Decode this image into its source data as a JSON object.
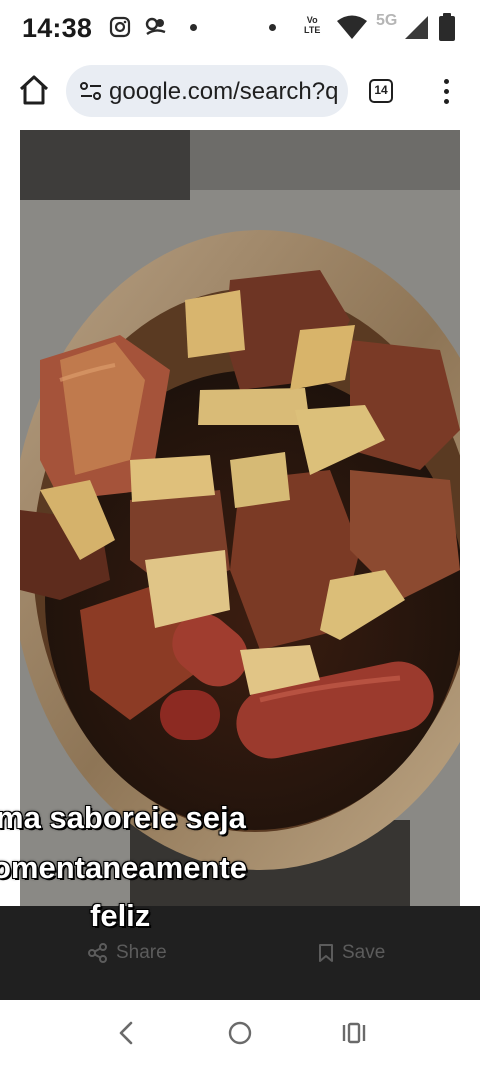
{
  "status_bar": {
    "time": "14:38",
    "network_label_1": "Vo",
    "network_label_2": "LTE",
    "network_5g": "5G",
    "icons": [
      "instagram-icon",
      "app-icon",
      "dot-icon",
      "dot-icon",
      "volte-icon",
      "wifi-icon",
      "signal-icon",
      "battery-icon"
    ]
  },
  "browser": {
    "url": "google.com/search?q",
    "tab_count": "14",
    "icons": [
      "home-icon",
      "site-settings-icon",
      "tabs-icon",
      "menu-icon"
    ]
  },
  "video": {
    "caption_line_1": "ma saboreie seja",
    "caption_line_2": "omentaneamente",
    "caption_line_3": "feliz"
  },
  "actions": {
    "share_label": "Share",
    "save_label": "Save"
  },
  "nav": {
    "icons": [
      "back-icon",
      "home-circle-icon",
      "recents-icon"
    ]
  },
  "colors": {
    "omnibox_bg": "#e9edf3",
    "action_bar_bg": "#202020"
  }
}
